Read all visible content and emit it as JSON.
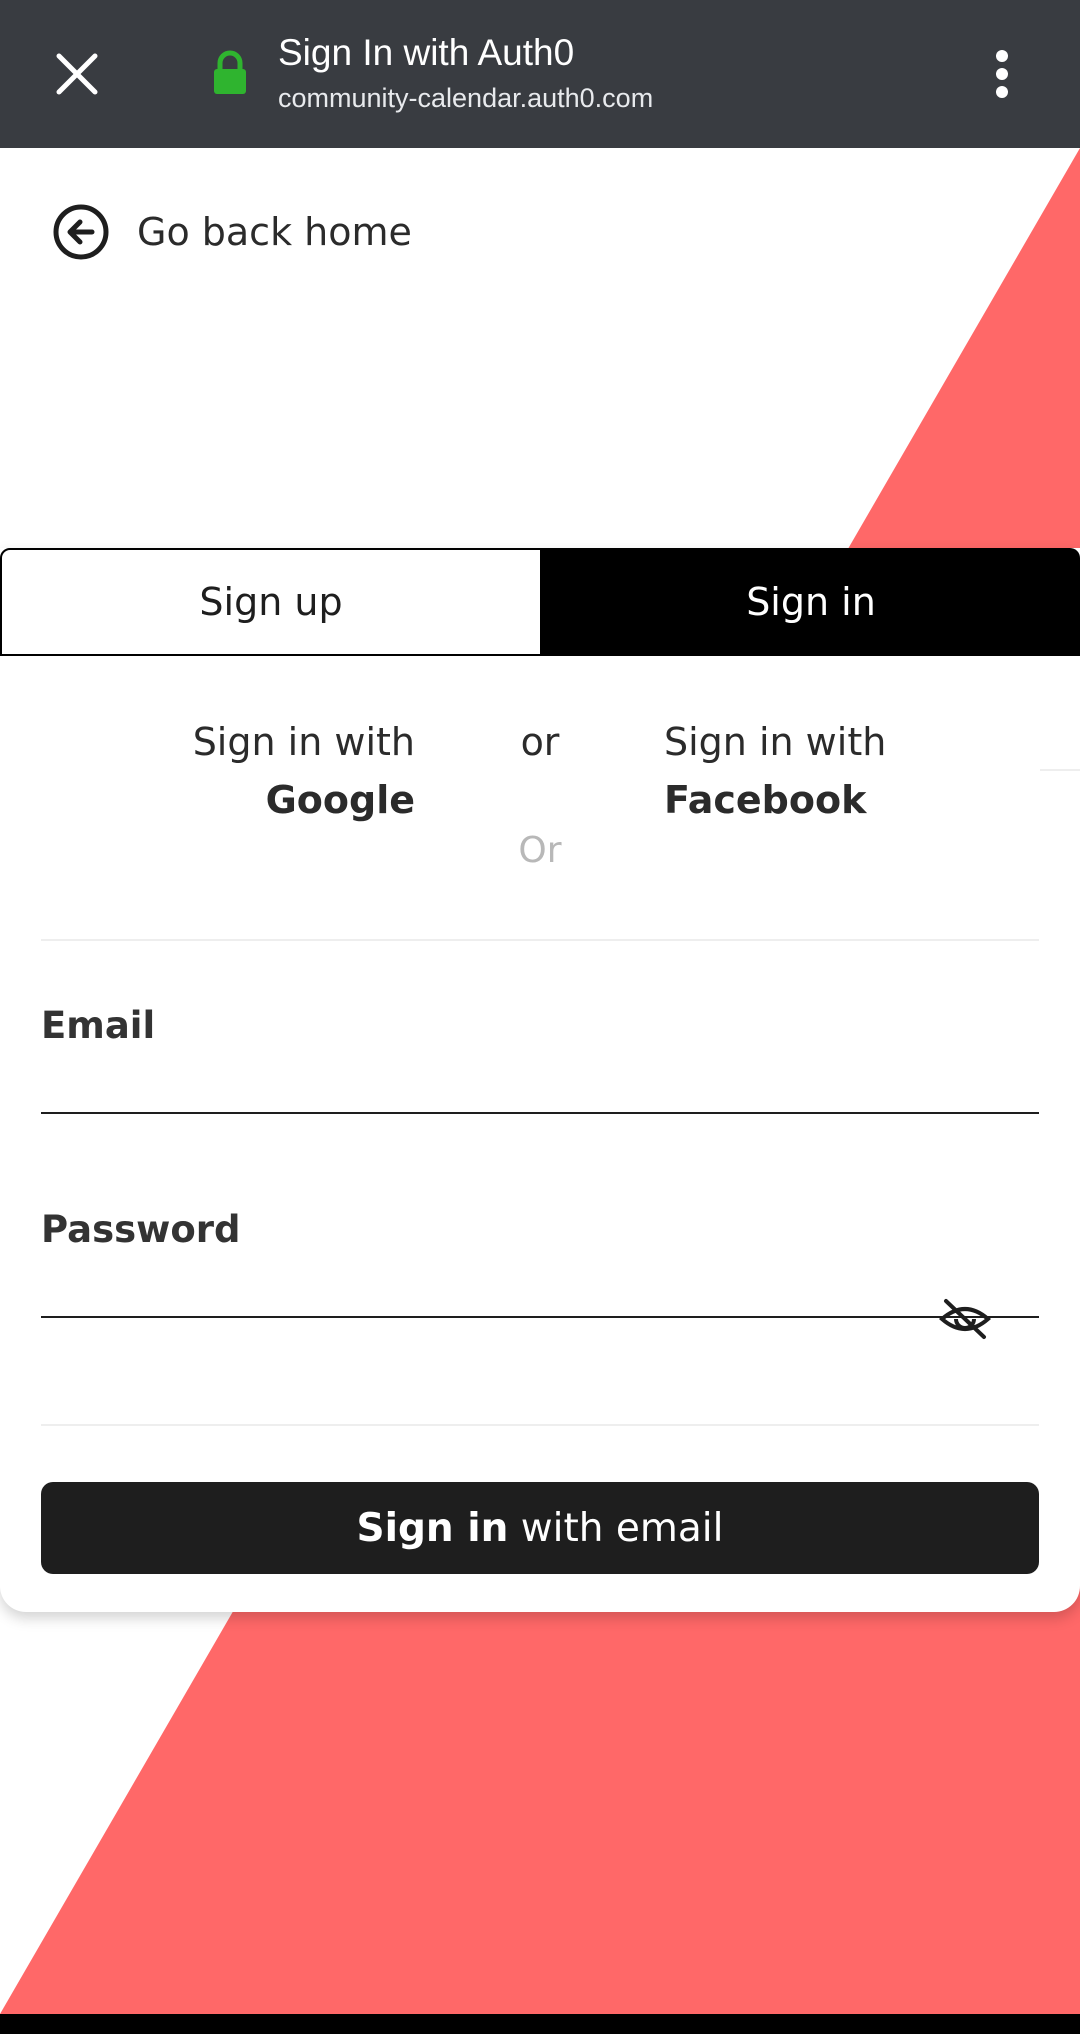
{
  "browser": {
    "title": "Sign In with Auth0",
    "url": "community-calendar.auth0.com",
    "lock_color": "#2fb42f",
    "bar_color": "#393c41"
  },
  "page": {
    "back_label": "Go back home",
    "accent_color": "#ff6868"
  },
  "tabs": {
    "signup": "Sign up",
    "signin": "Sign in",
    "active": "signin"
  },
  "social": {
    "google_prefix": "Sign in with",
    "google_brand": "Google",
    "or_between": "or",
    "facebook_prefix": "Sign in with",
    "facebook_brand": "Facebook",
    "or_divider": "Or"
  },
  "form": {
    "email_label": "Email",
    "email_value": "",
    "password_label": "Password",
    "password_value": "",
    "submit_strong": "Sign in",
    "submit_rest": " with email"
  },
  "icons": {
    "close": "close-icon",
    "lock": "lock-icon",
    "menu": "more-vert-icon",
    "back": "arrow-left-circle-icon",
    "password_toggle": "eye-off-icon"
  }
}
